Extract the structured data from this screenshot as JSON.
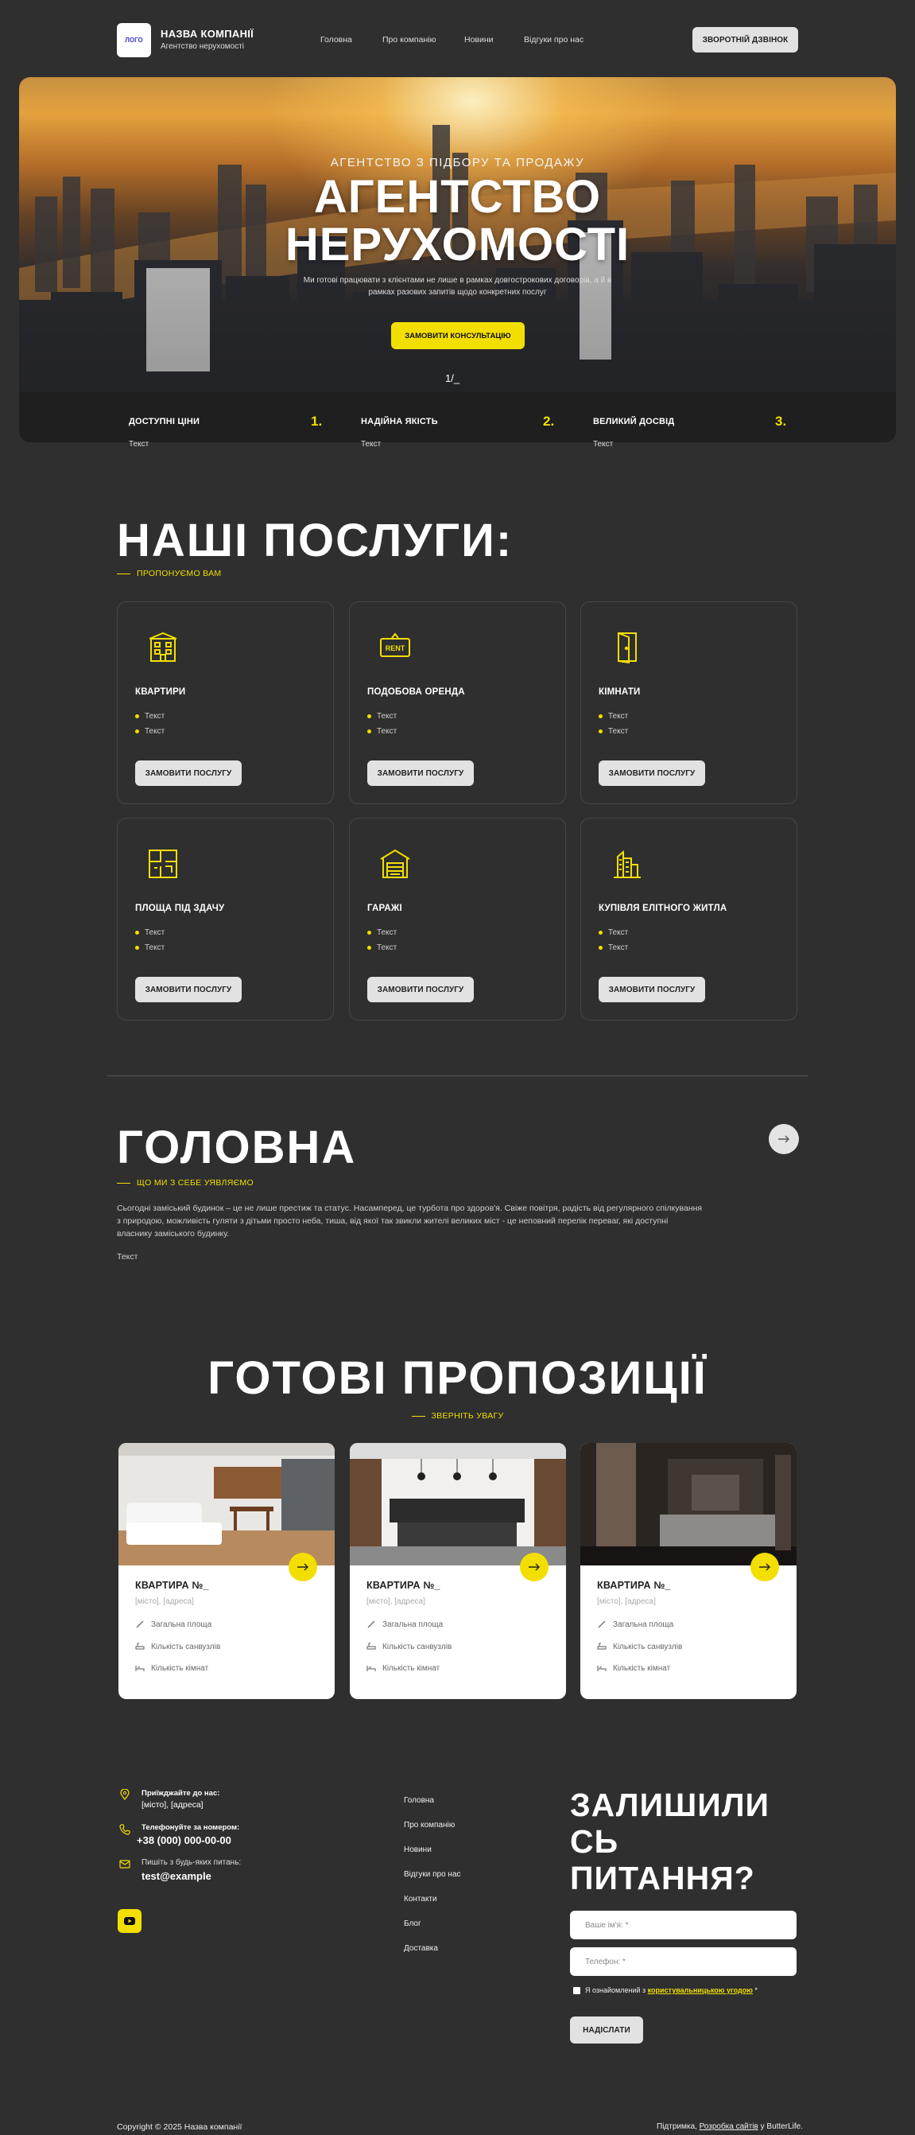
{
  "header": {
    "logo_text": "ЛОГО",
    "company_name": "НАЗВА КОМПАНІЇ",
    "company_sub": "Агентство нерухомості",
    "nav": [
      "Головна",
      "Про компанію",
      "Новини",
      "Відгуки про нас"
    ],
    "call_button": "ЗВОРОТНІЙ ДЗВІНОК"
  },
  "hero": {
    "kicker": "АГЕНТСТВО З ПІДБОРУ ТА ПРОДАЖУ",
    "title_line1": "АГЕНТСТВО",
    "title_line2": "НЕРУХОМОСТІ",
    "description": "Ми готові працювати з клієнтами не лише в рамках довгострокових договорів, а й в рамках разових запитів щодо конкретних послуг",
    "button": "ЗАМОВИТИ КОНСУЛЬТАЦІЮ",
    "slide_indicator": "1/_"
  },
  "features": [
    {
      "title": "ДОСТУПНІ ЦІНИ",
      "num": "1.",
      "text": "Текст"
    },
    {
      "title": "НАДІЙНА ЯКІСТЬ",
      "num": "2.",
      "text": "Текст"
    },
    {
      "title": "ВЕЛИКИЙ ДОСВІД",
      "num": "3.",
      "text": "Текст"
    }
  ],
  "services": {
    "title": "НАШІ ПОСЛУГИ:",
    "kicker": "ПРОПОНУЄМО ВАМ",
    "items": [
      {
        "title": "КВАРТИРИ",
        "bullets": [
          "Текст",
          "Текст"
        ],
        "button": "ЗАМОВИТИ ПОСЛУГУ",
        "icon": "apartment-building-icon"
      },
      {
        "title": "ПОДОБОВА ОРЕНДА",
        "bullets": [
          "Текст",
          "Текст"
        ],
        "button": "ЗАМОВИТИ ПОСЛУГУ",
        "icon": "rent-sign-icon",
        "icon_text": "RENT"
      },
      {
        "title": "КІМНАТИ",
        "bullets": [
          "Текст",
          "Текст"
        ],
        "button": "ЗАМОВИТИ ПОСЛУГУ",
        "icon": "door-icon"
      },
      {
        "title": "ПЛОЩА ПІД ЗДАЧУ",
        "bullets": [
          "Текст",
          "Текст"
        ],
        "button": "ЗАМОВИТИ ПОСЛУГУ",
        "icon": "floor-plan-icon"
      },
      {
        "title": "ГАРАЖІ",
        "bullets": [
          "Текст",
          "Текст"
        ],
        "button": "ЗАМОВИТИ ПОСЛУГУ",
        "icon": "garage-icon"
      },
      {
        "title": "КУПІВЛЯ ЕЛІТНОГО ЖИТЛА",
        "bullets": [
          "Текст",
          "Текст"
        ],
        "button": "ЗАМОВИТИ ПОСЛУГУ",
        "icon": "skyscraper-icon"
      }
    ]
  },
  "about": {
    "title": "ГОЛОВНА",
    "kicker": "ЩО МИ З СЕБЕ УЯВЛЯЄМО",
    "paragraph": "Сьогодні заміський будинок – це не лише престиж та статус. Насамперед, це турбота про здоров'я. Свіже повітря, радість від регулярного спілкування з природою, можливість гуляти з дітьми просто неба, тиша, від якої так звикли жителі великих міст - це неповний перелік переваг, які доступні власнику заміського будинку.",
    "text": "Текст"
  },
  "offers": {
    "title": "ГОТОВІ ПРОПОЗИЦІЇ",
    "kicker": "ЗВЕРНІТЬ УВАГУ",
    "items": [
      {
        "title": "КВАРТИРА №_",
        "address": "[місто], [адреса]",
        "props": [
          "Загальна площа",
          "Кількість санвузлів",
          "Кількість кімнат"
        ]
      },
      {
        "title": "КВАРТИРА №_",
        "address": "[місто], [адреса]",
        "props": [
          "Загальна площа",
          "Кількість санвузлів",
          "Кількість кімнат"
        ]
      },
      {
        "title": "КВАРТИРА №_",
        "address": "[місто], [адреса]",
        "props": [
          "Загальна площа",
          "Кількість санвузлів",
          "Кількість кімнат"
        ]
      }
    ]
  },
  "footer": {
    "address_label": "Приїжджайте до нас:",
    "address_value": "[місто], [адреса]",
    "phone_label": "Телефонуйте за номером:",
    "phone_value": "+38 (000) 000-00-00",
    "email_label": "Пишіть з будь-яких питань:",
    "email_value": "test@example",
    "links": [
      "Головна",
      "Про компанію",
      "Новини",
      "Відгуки про нас",
      "Контакти",
      "Блог",
      "Доставка"
    ],
    "form": {
      "title_line1": "ЗАЛИШИЛИ",
      "title_line2": "СЬ",
      "title_line3": "ПИТАННЯ?",
      "name_placeholder": "Ваше ім'я: *",
      "phone_placeholder": "Телефон: *",
      "agree_prefix": "Я ознайомлений з ",
      "agree_link": "користувальницькою угодою",
      "agree_suffix": " *",
      "submit": "НАДІСЛАТИ"
    },
    "copyright": "Copyright © 2025 Назва компанії",
    "credits_prefix": "Підтримка, ",
    "credits_link": "Розробка сайтів",
    "credits_suffix": " у ButterLife."
  },
  "colors": {
    "accent": "#f2df00",
    "background": "#2f2f2f",
    "button_light": "#e2e2e2"
  }
}
